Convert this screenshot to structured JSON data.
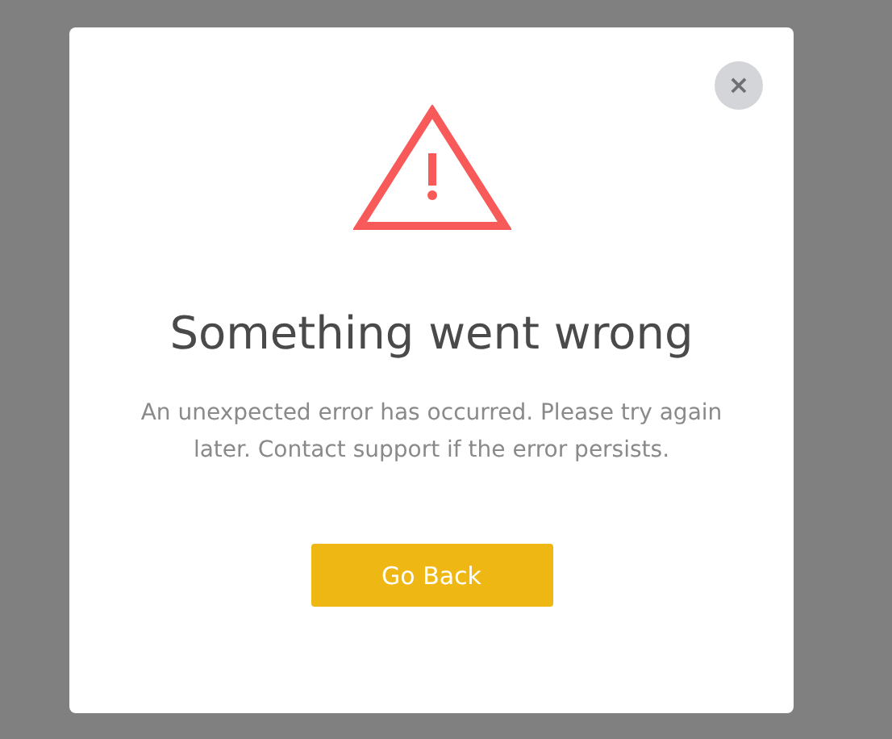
{
  "dialog": {
    "close_button": "×",
    "title": "Something went wrong",
    "message": "An unexpected error has occurred. Please try again later. Contact support if the error persists.",
    "buttons": [
      "Go Back"
    ]
  }
}
